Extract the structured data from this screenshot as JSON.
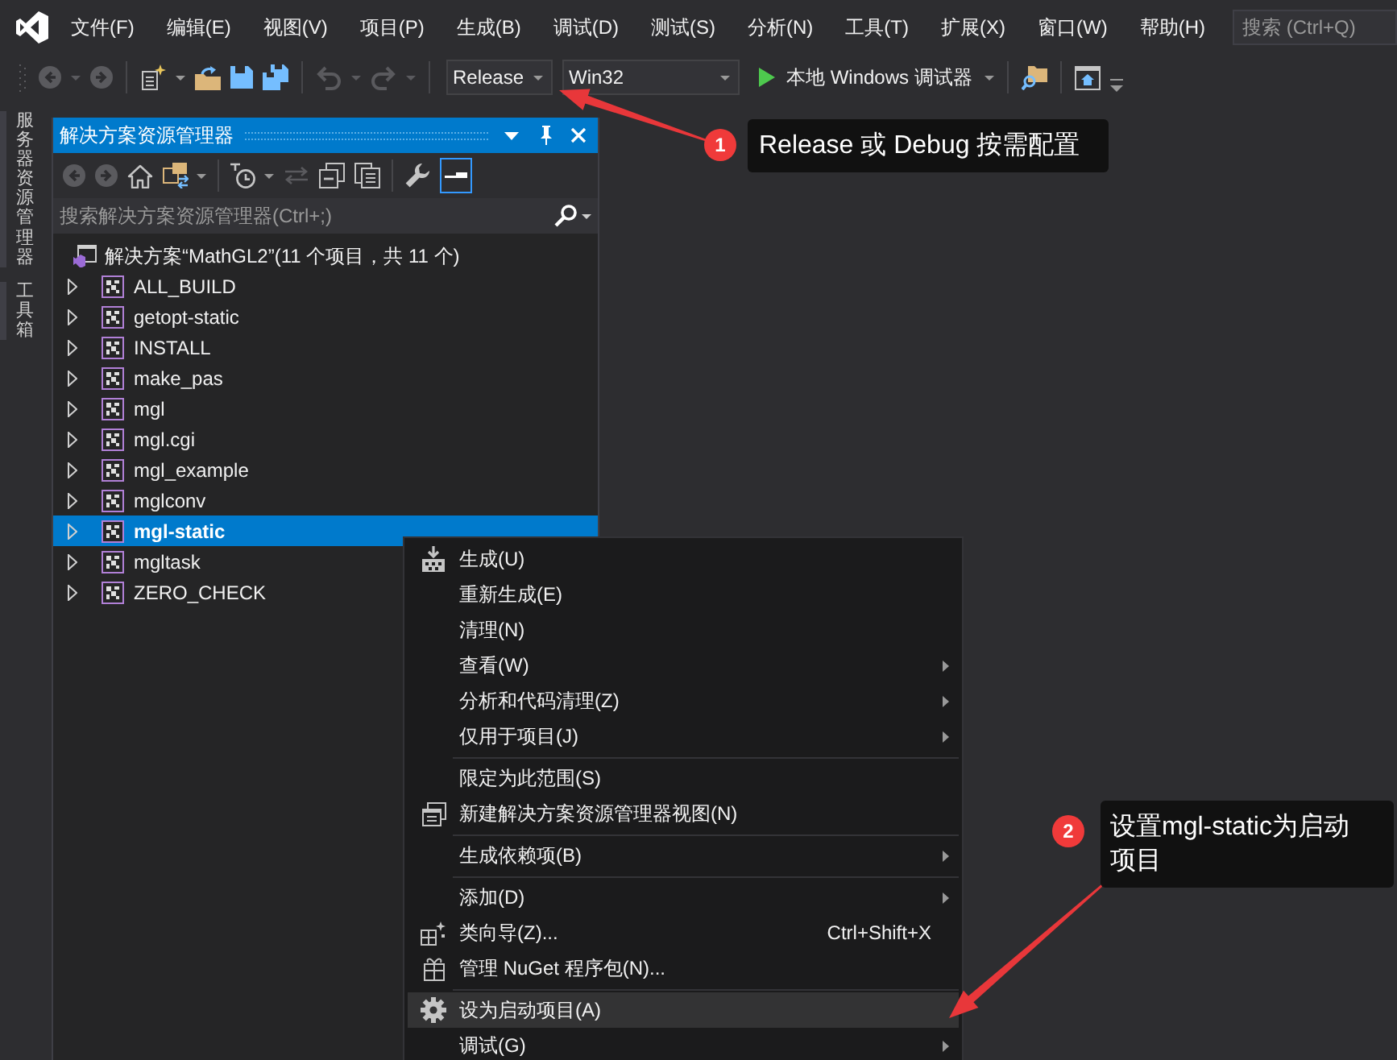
{
  "menu_bar": {
    "items": [
      "文件(F)",
      "编辑(E)",
      "视图(V)",
      "项目(P)",
      "生成(B)",
      "调试(D)",
      "测试(S)",
      "分析(N)",
      "工具(T)",
      "扩展(X)",
      "窗口(W)",
      "帮助(H)"
    ],
    "search": {
      "placeholder": "搜索 (Ctrl+Q)"
    }
  },
  "toolbar": {
    "items": [
      {
        "kind": "back",
        "disabled": true,
        "menu": true
      },
      {
        "kind": "forward",
        "disabled": true,
        "menu": false
      },
      {
        "kind": "separator"
      },
      {
        "kind": "new_project",
        "disabled": false,
        "menu": true
      },
      {
        "kind": "open",
        "disabled": false,
        "menu": false
      },
      {
        "kind": "save",
        "disabled": false,
        "menu": false
      },
      {
        "kind": "save_all",
        "disabled": false,
        "menu": false
      },
      {
        "kind": "separator"
      },
      {
        "kind": "undo",
        "disabled": true,
        "menu": true
      },
      {
        "kind": "redo",
        "disabled": true,
        "menu": true
      },
      {
        "kind": "separator"
      },
      {
        "kind": "configuration",
        "value": "Release"
      },
      {
        "kind": "platform",
        "value": "Win32"
      },
      {
        "kind": "start",
        "label": "本地 Windows 调试器"
      },
      {
        "kind": "separator"
      },
      {
        "kind": "find",
        "disabled": false,
        "menu": false
      },
      {
        "kind": "separator"
      },
      {
        "kind": "window",
        "disabled": false,
        "menu": false
      },
      {
        "kind": "overflow"
      }
    ]
  },
  "side_tabs": [
    "服务器资源管理器",
    "工具箱"
  ],
  "solution_explorer": {
    "title": "解决方案资源管理器",
    "toolbar": [
      {
        "kind": "back",
        "disabled": true,
        "on": false,
        "menu": false
      },
      {
        "kind": "forward",
        "disabled": true,
        "on": false,
        "menu": false
      },
      {
        "kind": "home",
        "disabled": false,
        "on": false,
        "menu": false
      },
      {
        "kind": "switch_views",
        "disabled": false,
        "on": false,
        "menu": true
      },
      {
        "kind": "separator"
      },
      {
        "kind": "history",
        "disabled": false,
        "on": false,
        "menu": true
      },
      {
        "kind": "sync",
        "disabled": true,
        "on": false,
        "menu": false
      },
      {
        "kind": "collapse_all",
        "disabled": false,
        "on": false,
        "menu": false
      },
      {
        "kind": "show_all_files",
        "disabled": false,
        "on": false,
        "menu": false
      },
      {
        "kind": "separator"
      },
      {
        "kind": "properties",
        "disabled": false,
        "on": false,
        "menu": false
      },
      {
        "kind": "preview",
        "disabled": false,
        "on": true,
        "menu": false
      }
    ],
    "search": {
      "placeholder": "搜索解决方案资源管理器(Ctrl+;)"
    },
    "tree": [
      {
        "kind": "solution",
        "label": "解决方案“MathGL2”(11 个项目，共 11 个)",
        "selected": false,
        "children": [
          {
            "kind": "project",
            "label": "ALL_BUILD",
            "expanded": false,
            "selected": false
          },
          {
            "kind": "project",
            "label": "getopt-static",
            "expanded": false,
            "selected": false
          },
          {
            "kind": "project",
            "label": "INSTALL",
            "expanded": false,
            "selected": false
          },
          {
            "kind": "project",
            "label": "make_pas",
            "expanded": false,
            "selected": false
          },
          {
            "kind": "project",
            "label": "mgl",
            "expanded": false,
            "selected": false
          },
          {
            "kind": "project",
            "label": "mgl.cgi",
            "expanded": false,
            "selected": false
          },
          {
            "kind": "project",
            "label": "mgl_example",
            "expanded": false,
            "selected": false
          },
          {
            "kind": "project",
            "label": "mglconv",
            "expanded": false,
            "selected": false
          },
          {
            "kind": "project",
            "label": "mgl-static",
            "expanded": false,
            "selected": true
          },
          {
            "kind": "project",
            "label": "mgltask",
            "expanded": false,
            "selected": false
          },
          {
            "kind": "project",
            "label": "ZERO_CHECK",
            "expanded": false,
            "selected": false
          }
        ]
      }
    ]
  },
  "context_menu": {
    "items": [
      {
        "kind": "build",
        "label": "生成(U)",
        "submenu": false,
        "selected": false
      },
      {
        "kind": "plain",
        "label": "重新生成(E)",
        "submenu": false,
        "selected": false
      },
      {
        "kind": "plain",
        "label": "清理(N)",
        "submenu": false,
        "selected": false
      },
      {
        "kind": "plain",
        "label": "查看(W)",
        "submenu": true,
        "selected": false
      },
      {
        "kind": "plain",
        "label": "分析和代码清理(Z)",
        "submenu": true,
        "selected": false
      },
      {
        "kind": "plain",
        "label": "仅用于项目(J)",
        "submenu": true,
        "selected": false
      },
      {
        "kind": "separator"
      },
      {
        "kind": "plain",
        "label": "限定为此范围(S)",
        "submenu": false,
        "selected": false
      },
      {
        "kind": "new_view",
        "label": "新建解决方案资源管理器视图(N)",
        "submenu": false,
        "selected": false
      },
      {
        "kind": "separator"
      },
      {
        "kind": "plain",
        "label": "生成依赖项(B)",
        "submenu": true,
        "selected": false
      },
      {
        "kind": "separator"
      },
      {
        "kind": "plain",
        "label": "添加(D)",
        "submenu": true,
        "selected": false
      },
      {
        "kind": "wizard",
        "label": "类向导(Z)...",
        "shortcut": "Ctrl+Shift+X",
        "submenu": false,
        "selected": false
      },
      {
        "kind": "package",
        "label": "管理 NuGet 程序包(N)...",
        "submenu": false,
        "selected": false
      },
      {
        "kind": "separator"
      },
      {
        "kind": "settings",
        "label": "设为启动项目(A)",
        "submenu": false,
        "selected": true
      },
      {
        "kind": "plain",
        "label": "调试(G)",
        "submenu": true,
        "selected": false
      }
    ]
  },
  "annotations": [
    {
      "number": "1",
      "text": "Release 或 Debug 按需配置"
    },
    {
      "number": "2",
      "text": "设置mgl-static为启动项目"
    }
  ]
}
